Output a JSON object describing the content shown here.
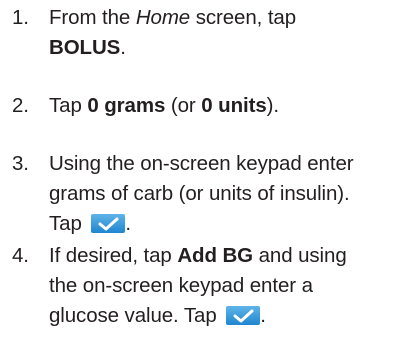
{
  "steps": [
    {
      "number": "1.",
      "line1_pre": "From the ",
      "line1_em": "Home",
      "line1_post": " screen, tap",
      "line2_bold": "BOLUS",
      "line2_post": "."
    },
    {
      "number": "2.",
      "pre": "Tap ",
      "bold1": "0 grams",
      "mid": " (or ",
      "bold2": "0 units",
      "post": ")."
    },
    {
      "number": "3.",
      "line1": "Using the on-screen keypad enter",
      "line2": "grams of carb (or units of insulin).",
      "line3_pre": "Tap ",
      "line3_post": ".",
      "button_icon": "checkmark-icon"
    },
    {
      "number": "4.",
      "line1_pre": "If desired, tap ",
      "line1_bold": "Add BG",
      "line1_post": " and using",
      "line2": "the on-screen keypad enter a",
      "line3_pre": "glucose value. Tap ",
      "line3_post": ".",
      "button_icon": "checkmark-icon"
    }
  ],
  "colors": {
    "text": "#231f20",
    "button_top": "#5fb4e8",
    "button_bottom": "#1f86cf",
    "check": "#ffffff"
  }
}
